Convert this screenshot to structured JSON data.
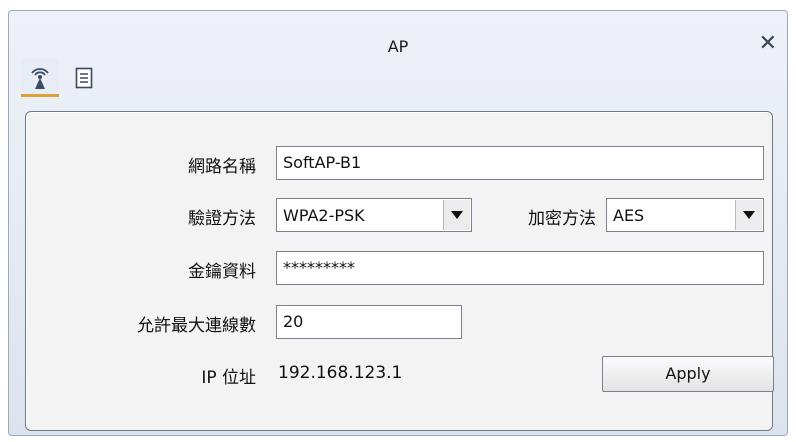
{
  "window": {
    "title": "AP"
  },
  "tabs": [
    {
      "icon": "antenna-icon"
    },
    {
      "icon": "document-icon"
    }
  ],
  "form": {
    "ssid_label": "網路名稱",
    "ssid_value": "SoftAP-B1",
    "auth_label": "驗證方法",
    "auth_value": "WPA2-PSK",
    "enc_label": "加密方法",
    "enc_value": "AES",
    "key_label": "金鑰資料",
    "key_value": "*********",
    "maxconn_label": "允許最大連線數",
    "maxconn_value": "20",
    "ip_label": "IP 位址",
    "ip_value": "192.168.123.1",
    "apply_label": "Apply"
  },
  "colors": {
    "accent": "#d9a338",
    "frame": "#9aa9c2"
  }
}
